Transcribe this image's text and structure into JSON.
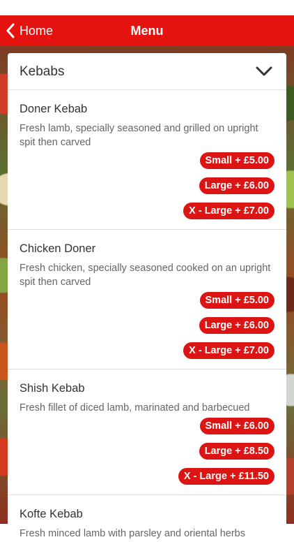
{
  "nav": {
    "back_label": "Home",
    "title": "Menu"
  },
  "category": {
    "title": "Kebabs"
  },
  "items": [
    {
      "name": "Doner Kebab",
      "description": "Fresh lamb, specially seasoned and grilled on upright spit then carved",
      "prices": [
        "Small + £5.00",
        "Large + £6.00",
        "X - Large + £7.00"
      ]
    },
    {
      "name": "Chicken Doner",
      "description": "Fresh chicken, specially seasoned cooked on an upright spit then carved",
      "prices": [
        "Small + £5.00",
        "Large + £6.00",
        "X - Large + £7.00"
      ]
    },
    {
      "name": "Shish Kebab",
      "description": "Fresh fillet of diced lamb, marinated and barbecued",
      "prices": [
        "Small + £6.00",
        "Large + £8.50",
        "X - Large + £11.50"
      ]
    },
    {
      "name": "Kofte Kebab",
      "description": "Fresh minced lamb with parsley and oriental herbs",
      "prices": []
    }
  ],
  "colors": {
    "nav_bar": "#e5130f",
    "price_pill": "#dc1414"
  },
  "icons": {
    "back": "chevron-left-icon",
    "collapse": "chevron-down-icon"
  }
}
